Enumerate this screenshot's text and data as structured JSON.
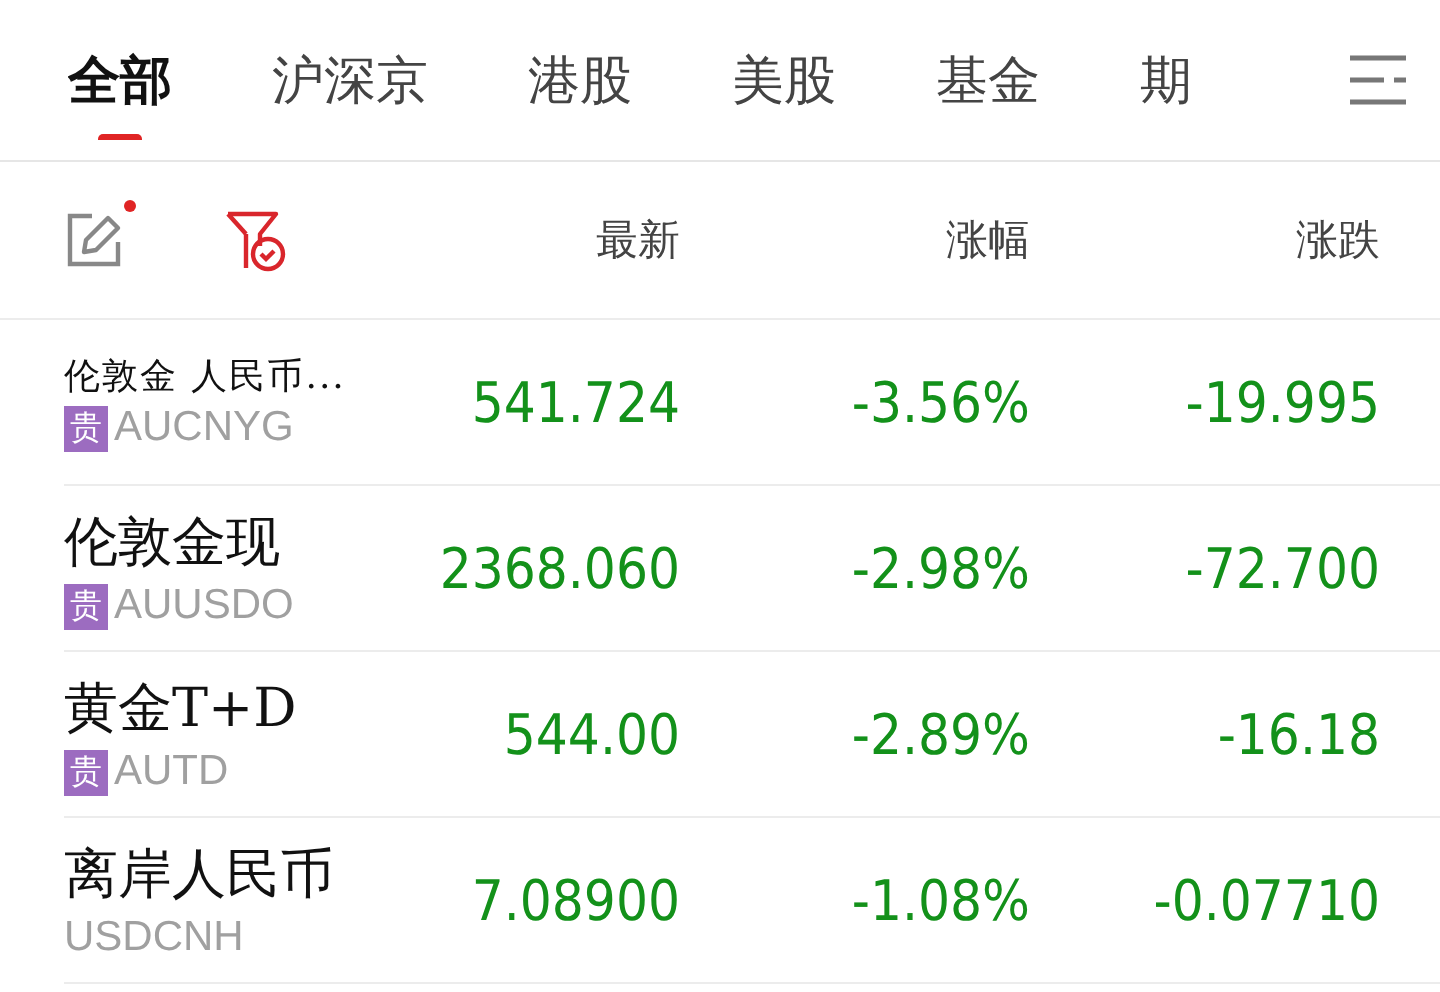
{
  "tabs": [
    {
      "label": "全部",
      "selected": true
    },
    {
      "label": "沪深京",
      "selected": false
    },
    {
      "label": "港股",
      "selected": false
    },
    {
      "label": "美股",
      "selected": false
    },
    {
      "label": "基金",
      "selected": false
    },
    {
      "label": "期",
      "selected": false
    }
  ],
  "toolbar": {
    "edit_has_dot": true
  },
  "columns": [
    "最新",
    "涨幅",
    "涨跌"
  ],
  "rows": [
    {
      "name": "伦敦金 人民币...",
      "badge": "贵",
      "code": "AUCNYG",
      "latest": "541.724",
      "change_pct": "-3.56%",
      "change": "-19.995"
    },
    {
      "name": "伦敦金现",
      "badge": "贵",
      "code": "AUUSDO",
      "latest": "2368.060",
      "change_pct": "-2.98%",
      "change": "-72.700"
    },
    {
      "name": "黄金T+D",
      "badge": "贵",
      "code": "AUTD",
      "latest": "544.00",
      "change_pct": "-2.89%",
      "change": "-16.18"
    },
    {
      "name": "离岸人民币",
      "code": "USDCNH",
      "latest": "7.08900",
      "change_pct": "-1.08%",
      "change": "-0.07710"
    }
  ]
}
